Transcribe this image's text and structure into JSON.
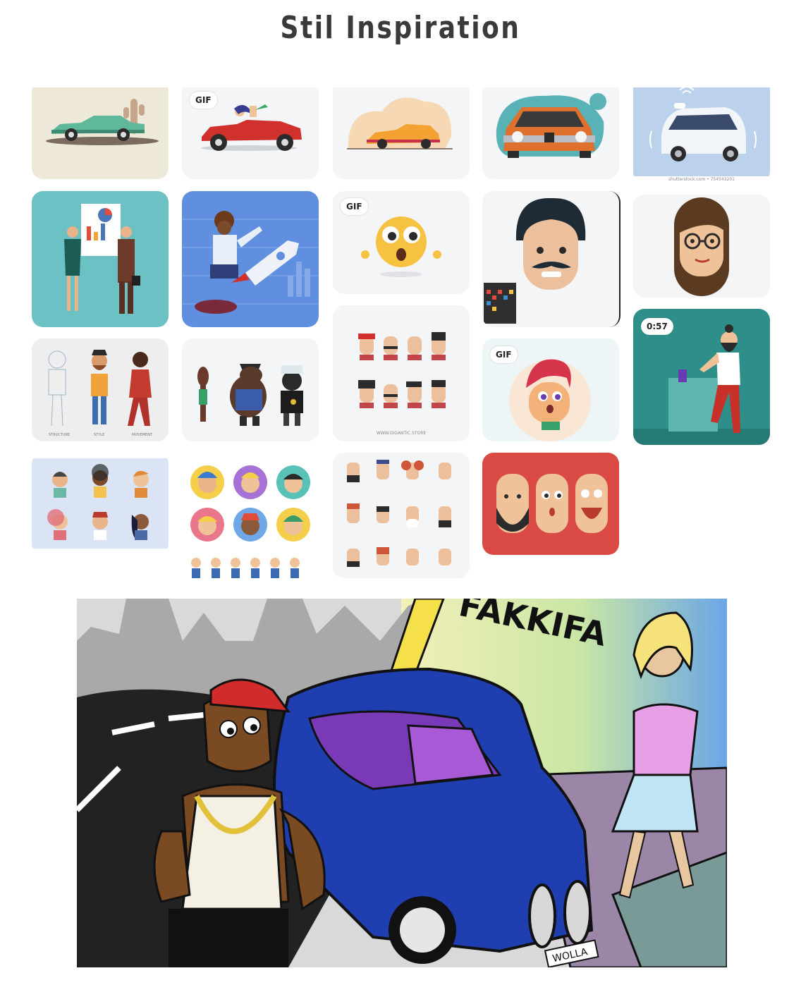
{
  "page": {
    "title": "Stil Inspiration"
  },
  "pins": [
    {
      "id": "green-car"
    },
    {
      "id": "red-convertible",
      "badge": "GIF"
    },
    {
      "id": "orange-sedan"
    },
    {
      "id": "orange-bmw"
    },
    {
      "id": "smart-car",
      "credit": "shutterstock.com • 754543201"
    },
    {
      "id": "business-people"
    },
    {
      "id": "rocket-businessman"
    },
    {
      "id": "shocked-emoji",
      "badge": "GIF"
    },
    {
      "id": "mustache-man"
    },
    {
      "id": "glasses-woman"
    },
    {
      "id": "head-variations",
      "credit": "WWW.GIGANTIC.STORE"
    },
    {
      "id": "character-stages",
      "captions": [
        "STRUCTURE",
        "STYLE",
        "MOVEMENT"
      ]
    },
    {
      "id": "animal-characters"
    },
    {
      "id": "boy-avatar",
      "badge": "GIF"
    },
    {
      "id": "bearded-man-video",
      "badge": "0:57"
    },
    {
      "id": "avatar-grid-blue"
    },
    {
      "id": "round-avatars"
    },
    {
      "id": "faces-grid"
    },
    {
      "id": "three-heads"
    }
  ],
  "comic": {
    "sign_text": "FAKKIFA",
    "plate_text": "WOLLA"
  }
}
